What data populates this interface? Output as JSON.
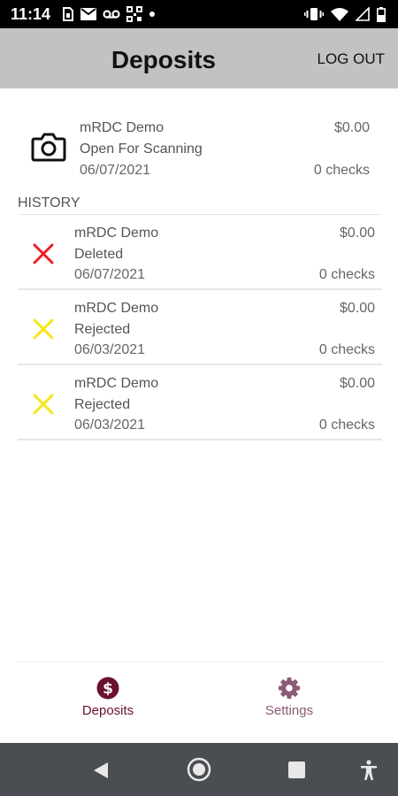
{
  "status_bar": {
    "time": "11:14",
    "left_icons": [
      "sim-card-icon",
      "mail-icon",
      "voicemail-icon",
      "qr-code-icon",
      "dot-icon"
    ],
    "right_icons": [
      "vibrate-icon",
      "wifi-icon",
      "signal-icon",
      "battery-icon"
    ]
  },
  "header": {
    "title": "Deposits",
    "logout_label": "LOG OUT",
    "background": "#c2c2c2"
  },
  "current_deposit": {
    "name": "mRDC Demo",
    "status": "Open For Scanning",
    "date": "06/07/2021",
    "amount": "$0.00",
    "checks": "0 checks",
    "icon": "camera-icon"
  },
  "history": {
    "label": "HISTORY",
    "items": [
      {
        "name": "mRDC Demo",
        "status": "Deleted",
        "date": "06/07/2021",
        "amount": "$0.00",
        "checks": "0 checks",
        "icon": "x-icon",
        "icon_color": "#ee1c25"
      },
      {
        "name": "mRDC Demo",
        "status": "Rejected",
        "date": "06/03/2021",
        "amount": "$0.00",
        "checks": "0 checks",
        "icon": "x-icon",
        "icon_color": "#f5e616"
      },
      {
        "name": "mRDC Demo",
        "status": "Rejected",
        "date": "06/03/2021",
        "amount": "$0.00",
        "checks": "0 checks",
        "icon": "x-icon",
        "icon_color": "#f5e616"
      }
    ]
  },
  "bottom_nav": {
    "deposits_label": "Deposits",
    "settings_label": "Settings",
    "active_color": "#6b1230",
    "inactive_color": "#8b5a74"
  },
  "system_nav": {
    "buttons": [
      "back-icon",
      "home-icon",
      "recents-icon",
      "accessibility-icon"
    ],
    "background": "#4a4d52"
  }
}
